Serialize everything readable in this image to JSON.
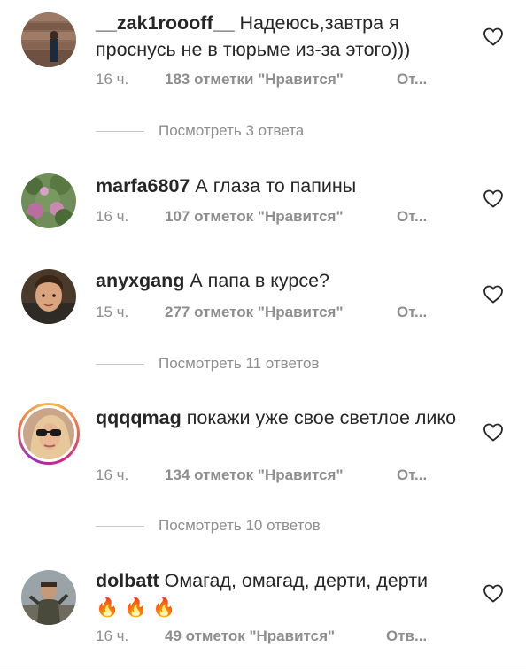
{
  "comments": [
    {
      "username": "__zak1roooff__",
      "text": "Надеюсь,завтра я проснусь не в тюрьме из-за этого)))",
      "time": "16 ч.",
      "likes": "183 отметки \"Нравится\"",
      "reply": "От..."
    },
    {
      "username": "marfa6807",
      "text": "А глаза то папины",
      "time": "16 ч.",
      "likes": "107 отметок \"Нравится\"",
      "reply": "От..."
    },
    {
      "username": "anyxgang",
      "text": "А папа в курсе?",
      "time": "15 ч.",
      "likes": "277 отметок \"Нравится\"",
      "reply": "От..."
    },
    {
      "username": "qqqqmag",
      "text": "покажи уже свое светлое лико",
      "time": "16 ч.",
      "likes": "134 отметок \"Нравится\"",
      "reply": "От..."
    },
    {
      "username": "dolbatt",
      "text": "Омагад, омагад, дерти, дерти",
      "emoji": "🔥🔥🔥",
      "time": "16 ч.",
      "likes": "49 отметок \"Нравится\"",
      "reply": "Отв..."
    }
  ],
  "replies": [
    {
      "label": "Посмотреть 3 ответа"
    },
    {
      "label": "Посмотреть 11 ответов"
    },
    {
      "label": "Посмотреть 10 ответов"
    }
  ],
  "icons": {
    "like": "heart-outline-icon",
    "story_ring": "story-ring-gradient"
  },
  "colors": {
    "text": "#262626",
    "secondary": "#8e8e8e",
    "divider": "#c7c7c7"
  }
}
